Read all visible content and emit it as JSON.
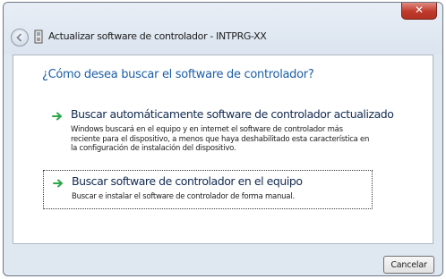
{
  "window": {
    "title": "Actualizar software de controlador - INTPRG-XX",
    "close_glyph": "✕"
  },
  "main": {
    "heading": "¿Cómo desea buscar el software de controlador?",
    "options": [
      {
        "title": "Buscar automáticamente software de controlador actualizado",
        "description_lines": [
          "Windows buscará en el equipo y en internet el software de controlador más",
          "reciente para el dispositivo, a menos que haya deshabilitado esta característica en",
          "la configuración de instalación del dispositivo."
        ],
        "icon": "green-arrow-icon"
      },
      {
        "title": "Buscar software de controlador en el equipo",
        "description_lines": [
          "Buscar e instalar el software de controlador de forma manual."
        ],
        "icon": "green-arrow-icon"
      }
    ]
  },
  "footer": {
    "cancel_label": "Cancelar"
  },
  "colors": {
    "heading": "#1c5fa6",
    "accent_arrow": "#2fa84a",
    "close_button": "#c0392b"
  }
}
